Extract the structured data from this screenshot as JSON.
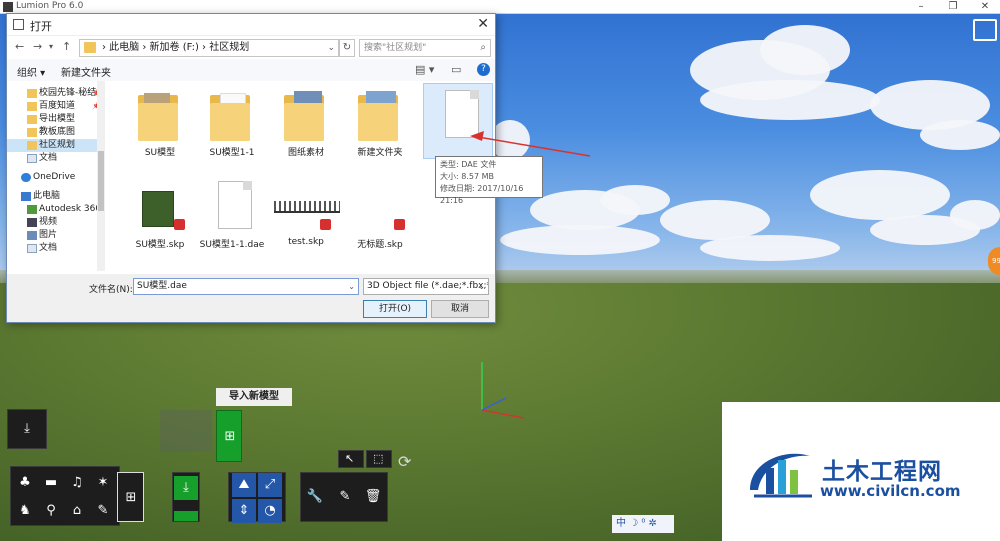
{
  "app": {
    "title": "Lumion Pro 6.0",
    "min_icon": "minimize-icon",
    "max_icon": "maximize-icon",
    "close_icon": "close-icon"
  },
  "dialog": {
    "title": "打开",
    "close": "✕",
    "nav": {
      "back": "←",
      "forward": "→",
      "up": "↑"
    },
    "breadcrumb": [
      "此电脑",
      "新加卷 (F:)",
      "社区规划"
    ],
    "breadcrumb_text": "› 此电脑 › 新加卷 (F:) › 社区规划",
    "refresh": "↻",
    "search_placeholder": "搜索\"社区规划\"",
    "toolbar": {
      "organize": "组织 ▾",
      "new_folder": "新建文件夹"
    },
    "nav_items": [
      {
        "label": "校园先锋-秘结",
        "pinned": true
      },
      {
        "label": "百度知道",
        "pinned": true
      },
      {
        "label": "导出模型"
      },
      {
        "label": "教板底图"
      },
      {
        "label": "社区规划",
        "selected": true
      },
      {
        "label": "文档"
      }
    ],
    "nav_onedrive": "OneDrive",
    "nav_pc": "此电脑",
    "nav_pc_items": [
      "Autodesk 360",
      "视频",
      "图片",
      "文档"
    ],
    "files": [
      {
        "label": "SU模型",
        "type": "folder"
      },
      {
        "label": "SU模型1-1",
        "type": "folder"
      },
      {
        "label": "图纸素材",
        "type": "folder"
      },
      {
        "label": "新建文件夹",
        "type": "folder"
      },
      {
        "label": "",
        "type": "dae-hover"
      },
      {
        "label": "SU模型.skp",
        "type": "skp"
      },
      {
        "label": "SU模型1-1.dae",
        "type": "doc"
      },
      {
        "label": "test.skp",
        "type": "skp"
      },
      {
        "label": "无标题.skp",
        "type": "skp"
      }
    ],
    "tooltip": {
      "type": "类型: DAE 文件",
      "size": "大小: 8.57 MB",
      "date": "修改日期: 2017/10/16 21:16"
    },
    "filename_label": "文件名(N):",
    "filename_value": "SU模型.dae",
    "filetype_value": "3D Object file (*.dae;*.fbx;*.s",
    "open_button": "打开(O)",
    "cancel_button": "取消"
  },
  "lumion": {
    "import_label": "导入新模型",
    "status": "中 ☽ ⁰ ✲",
    "side_badge": "99"
  },
  "watermark": {
    "title": "土木工程网",
    "url": "www.civilcn.com"
  },
  "colors": {
    "accent": "#1f6ccf",
    "import_green": "#16a02b",
    "watermark_blue": "#1b4fa0",
    "annotation_red": "#d9322e"
  }
}
